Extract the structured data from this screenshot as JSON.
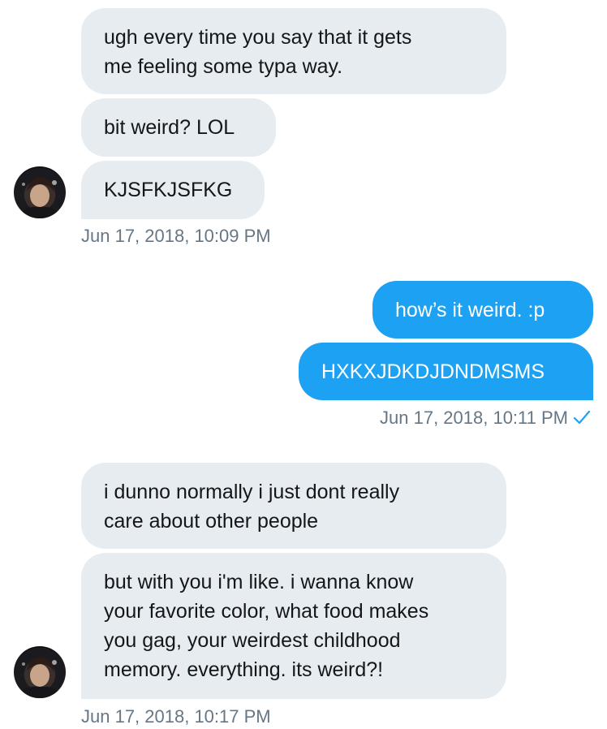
{
  "conversation": {
    "group1": {
      "messages": [
        "ugh every time you say that it gets\nme feeling some typa way.",
        "bit weird? LOL",
        "KJSFKJSFKG"
      ],
      "timestamp": "Jun 17, 2018, 10:09 PM"
    },
    "group2": {
      "messages": [
        "how’s it weird. :p",
        "HXKXJDKDJDNDMSMS"
      ],
      "timestamp": "Jun 17, 2018, 10:11 PM"
    },
    "group3": {
      "messages": [
        "i dunno normally i just dont really\ncare about other people",
        "but with you i'm like. i wanna know\nyour favorite color, what food makes\nyou gag, your weirdest childhood\nmemory. everything. its weird?!"
      ],
      "timestamp": "Jun 17, 2018, 10:17 PM"
    }
  },
  "icons": {
    "read_receipt": "checkmark-icon",
    "avatar": "user-avatar"
  },
  "colors": {
    "incoming_bubble": "#e6ecf0",
    "outgoing_bubble": "#1da1f2",
    "timestamp_text": "#657786",
    "checkmark": "#1da1f2"
  }
}
